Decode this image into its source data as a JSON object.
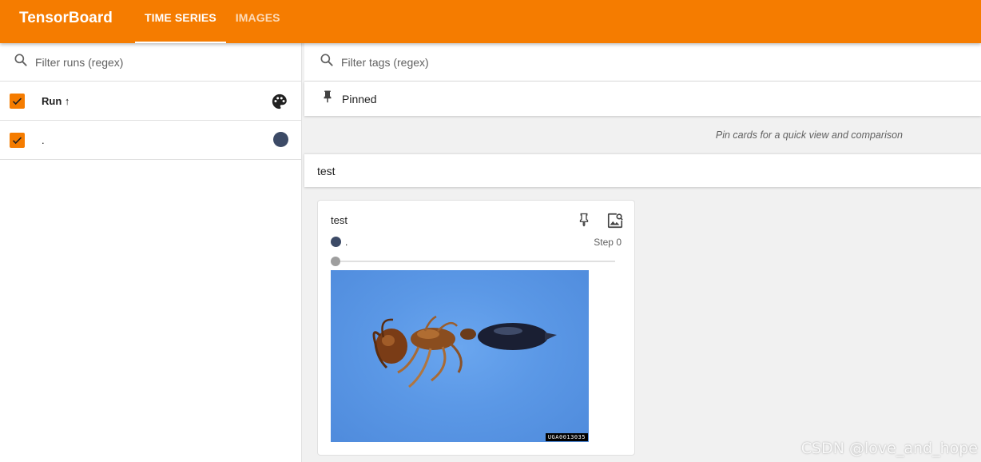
{
  "app": {
    "brand": "TensorBoard",
    "tabs": [
      {
        "label": "TIME SERIES",
        "active": true
      },
      {
        "label": "IMAGES",
        "active": false
      }
    ],
    "accent_color": "#f57c00"
  },
  "sidebar": {
    "filter": {
      "placeholder": "Filter runs (regex)",
      "icon": "search-icon"
    },
    "header": {
      "label": "Run ↑",
      "checked": true,
      "icon": "palette-icon"
    },
    "runs": [
      {
        "name": ".",
        "checked": true,
        "color": "#3c4a66"
      }
    ]
  },
  "main": {
    "filter": {
      "placeholder": "Filter tags (regex)",
      "icon": "search-icon"
    },
    "pinned": {
      "label": "Pinned",
      "icon": "pin-icon",
      "hint": "Pin cards for a quick view and comparison"
    },
    "group": {
      "title": "test"
    },
    "card": {
      "title": "test",
      "run_name": ".",
      "run_color": "#3c4a66",
      "step_label": "Step 0",
      "slider_value": 0,
      "image_id": "UGA0013035",
      "icons": [
        "pin-icon",
        "image-search-icon"
      ]
    }
  },
  "watermark": "CSDN @love_and_hope"
}
